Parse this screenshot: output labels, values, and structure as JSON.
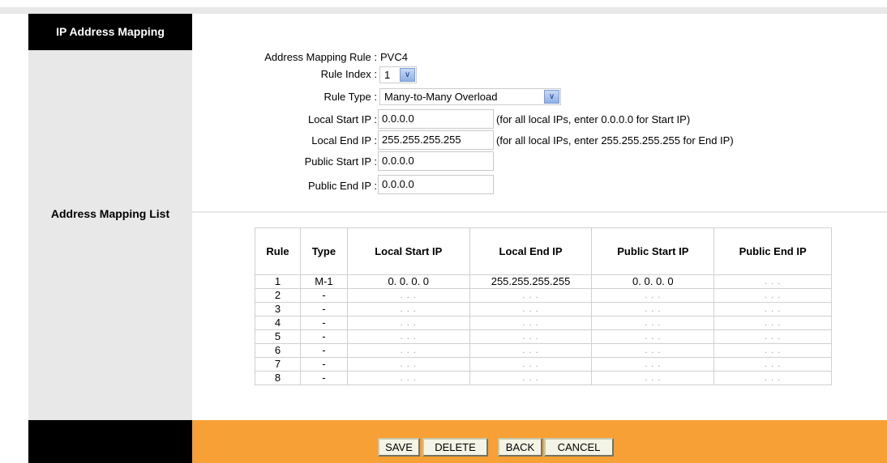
{
  "sections": {
    "ip_address_mapping": "IP Address Mapping",
    "address_mapping_list": "Address Mapping List"
  },
  "form": {
    "mapping_rule_label": "Address Mapping Rule :",
    "mapping_rule_value": "PVC4",
    "rule_index_label": "Rule Index :",
    "rule_index_value": "1",
    "rule_type_label": "Rule Type :",
    "rule_type_value": "Many-to-Many Overload",
    "local_start_ip_label": "Local Start IP :",
    "local_start_ip_value": "0.0.0.0",
    "local_start_ip_hint": "(for all local IPs, enter 0.0.0.0 for Start IP)",
    "local_end_ip_label": "Local End IP :",
    "local_end_ip_value": "255.255.255.255",
    "local_end_ip_hint": "(for all local IPs, enter 255.255.255.255 for End IP)",
    "public_start_ip_label": "Public Start IP :",
    "public_start_ip_value": "0.0.0.0",
    "public_end_ip_label": "Public End IP :",
    "public_end_ip_value": "0.0.0.0"
  },
  "table": {
    "headers": [
      "Rule",
      "Type",
      "Local Start IP",
      "Local End IP",
      "Public Start IP",
      "Public End IP"
    ],
    "rows": [
      [
        "1",
        "M-1",
        "0. 0. 0. 0",
        "255.255.255.255",
        "0. 0. 0. 0",
        ". . ."
      ],
      [
        "2",
        "-",
        ". . .",
        ". . .",
        ". . .",
        ". . ."
      ],
      [
        "3",
        "-",
        ". . .",
        ". . .",
        ". . .",
        ". . ."
      ],
      [
        "4",
        "-",
        ". . .",
        ". . .",
        ". . .",
        ". . ."
      ],
      [
        "5",
        "-",
        ". . .",
        ". . .",
        ". . .",
        ". . ."
      ],
      [
        "6",
        "-",
        ". . .",
        ". . .",
        ". . .",
        ". . ."
      ],
      [
        "7",
        "-",
        ". . .",
        ". . .",
        ". . .",
        ". . ."
      ],
      [
        "8",
        "-",
        ". . .",
        ". . .",
        ". . .",
        ". . ."
      ]
    ]
  },
  "buttons": {
    "save": "SAVE",
    "delete": "DELETE",
    "back": "BACK",
    "cancel": "CANCEL"
  },
  "colors": {
    "footer_accent": "#f7a035",
    "sidebar": "#e8e8e8"
  },
  "icons": {
    "dropdown": "chevron-down-icon"
  }
}
